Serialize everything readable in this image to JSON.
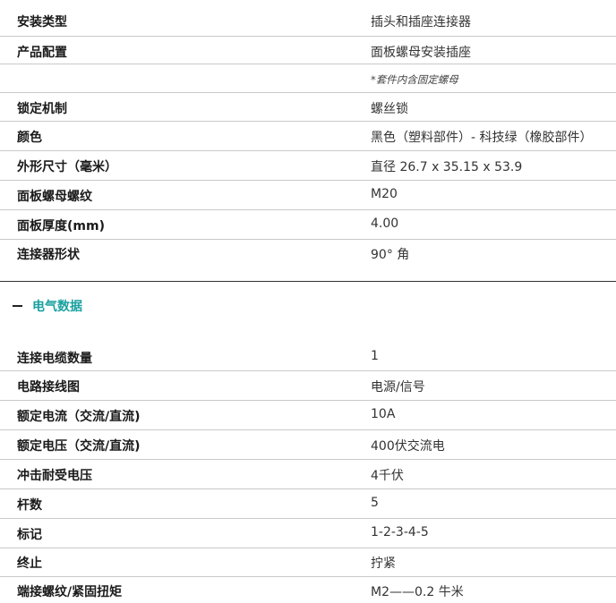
{
  "spec_rows": [
    {
      "label": "安装类型",
      "value": "插头和插座连接器"
    },
    {
      "label": "产品配置",
      "value": "面板螺母安装插座"
    },
    {
      "label": "",
      "value": "",
      "note": "*套件内含固定螺母"
    },
    {
      "label": "锁定机制",
      "value": "螺丝锁"
    },
    {
      "label": "颜色",
      "value": "黑色（塑料部件）- 科技绿（橡胶部件）"
    },
    {
      "label": "外形尺寸（毫米）",
      "value": "直径 26.7 x 35.15 x 53.9"
    },
    {
      "label": "面板螺母螺纹",
      "value": "M20"
    },
    {
      "label": "面板厚度(mm)",
      "value": "4.00"
    },
    {
      "label": "连接器形状",
      "value": "90° 角"
    }
  ],
  "electrical_section": {
    "toggle_icon": "minus-icon",
    "title": "电气数据",
    "title_color": "#1aa0a0",
    "rows": [
      {
        "label": "连接电缆数量",
        "value": "1"
      },
      {
        "label": "电路接线图",
        "value": "电源/信号"
      },
      {
        "label": "额定电流（交流/直流)",
        "value": "10A"
      },
      {
        "label": "额定电压（交流/直流)",
        "value": "400伏交流电"
      },
      {
        "label": "冲击耐受电压",
        "value": "4千伏"
      },
      {
        "label": "杆数",
        "value": "5"
      },
      {
        "label": "标记",
        "value": "1-2-3-4-5"
      },
      {
        "label": "终止",
        "value": "拧紧"
      },
      {
        "label": "端接螺纹/紧固扭矩",
        "value": "M2——0.2 牛米"
      }
    ]
  }
}
